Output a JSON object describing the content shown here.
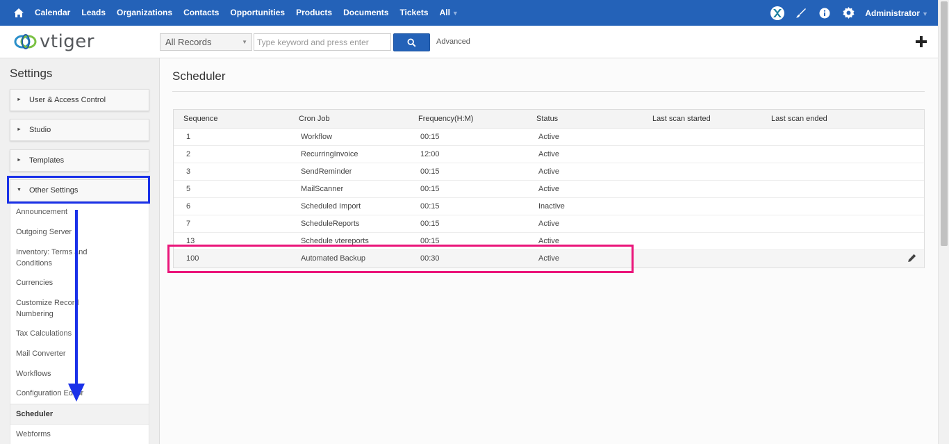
{
  "topnav": {
    "home_icon": "home-icon",
    "items": [
      "Calendar",
      "Leads",
      "Organizations",
      "Contacts",
      "Opportunities",
      "Products",
      "Documents",
      "Tickets",
      "All"
    ],
    "user": "Administrator"
  },
  "header": {
    "logo_text": "vtiger",
    "search_scope": "All Records",
    "search_placeholder": "Type keyword and press enter",
    "advanced_label": "Advanced"
  },
  "sidebar": {
    "title": "Settings",
    "sections": [
      "User & Access Control",
      "Studio",
      "Templates",
      "Other Settings"
    ],
    "other_settings_items": [
      "Announcement",
      "Outgoing Server",
      "Inventory: Terms and Conditions",
      "Currencies",
      "Customize Record Numbering",
      "Tax Calculations",
      "Mail Converter",
      "Workflows",
      "Configuration Editor",
      "Scheduler",
      "Webforms"
    ],
    "active_item": "Scheduler"
  },
  "main": {
    "title": "Scheduler",
    "columns": [
      "Sequence",
      "Cron Job",
      "Frequency(H:M)",
      "Status",
      "Last scan started",
      "Last scan ended"
    ],
    "rows": [
      {
        "seq": "1",
        "job": "Workflow",
        "freq": "00:15",
        "status": "Active"
      },
      {
        "seq": "2",
        "job": "RecurringInvoice",
        "freq": "12:00",
        "status": "Active"
      },
      {
        "seq": "3",
        "job": "SendReminder",
        "freq": "00:15",
        "status": "Active"
      },
      {
        "seq": "5",
        "job": "MailScanner",
        "freq": "00:15",
        "status": "Active"
      },
      {
        "seq": "6",
        "job": "Scheduled Import",
        "freq": "00:15",
        "status": "Inactive"
      },
      {
        "seq": "7",
        "job": "ScheduleReports",
        "freq": "00:15",
        "status": "Active"
      },
      {
        "seq": "13",
        "job": "Schedule vtereports",
        "freq": "00:15",
        "status": "Active"
      },
      {
        "seq": "100",
        "job": "Automated Backup",
        "freq": "00:30",
        "status": "Active"
      }
    ]
  },
  "colors": {
    "nav_blue": "#2462b8",
    "annotation_blue": "#1a31e8",
    "annotation_pink": "#ea157a"
  }
}
